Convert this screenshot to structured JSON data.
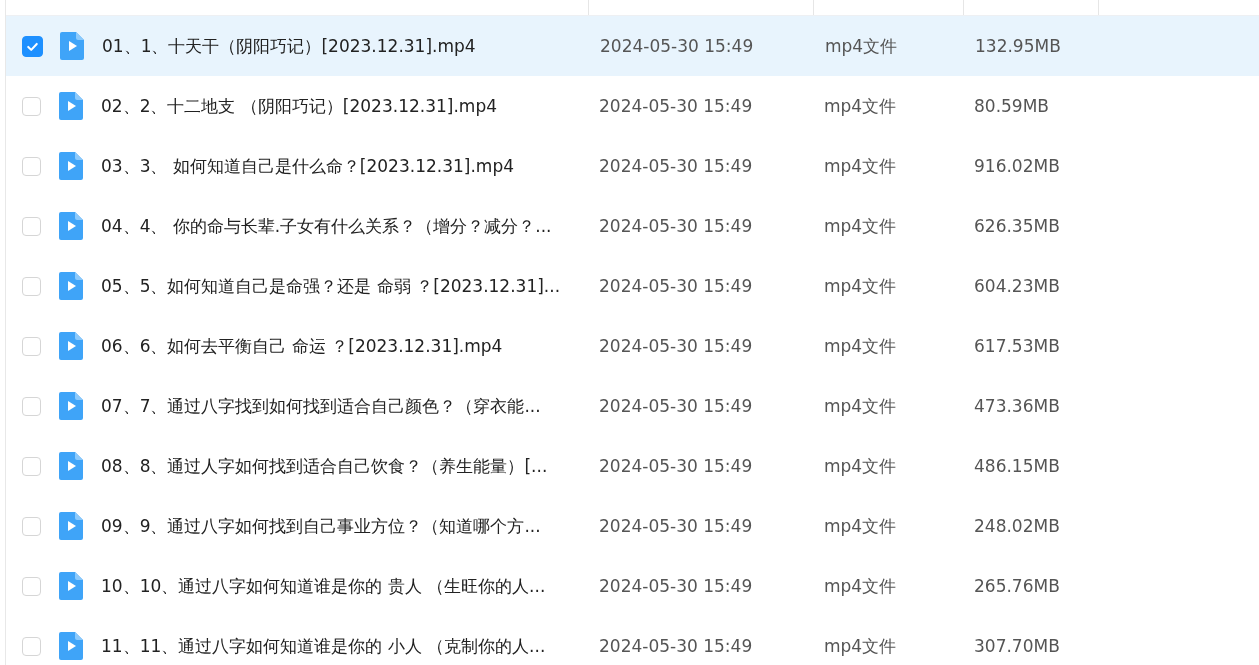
{
  "table": {
    "columns": [
      {
        "kind": "check"
      },
      {
        "kind": "name"
      },
      {
        "kind": "date"
      },
      {
        "kind": "type"
      },
      {
        "kind": "size"
      }
    ],
    "rows": [
      {
        "selected": true,
        "name": "01、1、十天干（阴阳巧记）[2023.12.31].mp4",
        "modified": "2024-05-30 15:49",
        "type": "mp4文件",
        "size": "132.95MB"
      },
      {
        "selected": false,
        "name": "02、2、十二地支 （阴阳巧记）[2023.12.31].mp4",
        "modified": "2024-05-30 15:49",
        "type": "mp4文件",
        "size": "80.59MB"
      },
      {
        "selected": false,
        "name": "03、3、 如何知道自己是什么命？[2023.12.31].mp4",
        "modified": "2024-05-30 15:49",
        "type": "mp4文件",
        "size": "916.02MB"
      },
      {
        "selected": false,
        "name": "04、4、 你的命与长辈.子女有什么关系？（增分？减分？...",
        "modified": "2024-05-30 15:49",
        "type": "mp4文件",
        "size": "626.35MB"
      },
      {
        "selected": false,
        "name": "05、5、如何知道自己是命强？还是 命弱 ？[2023.12.31]...",
        "modified": "2024-05-30 15:49",
        "type": "mp4文件",
        "size": "604.23MB"
      },
      {
        "selected": false,
        "name": "06、6、如何去平衡自己 命运 ？[2023.12.31].mp4",
        "modified": "2024-05-30 15:49",
        "type": "mp4文件",
        "size": "617.53MB"
      },
      {
        "selected": false,
        "name": "07、7、通过八字找到如何找到适合自己颜色？（穿衣能...",
        "modified": "2024-05-30 15:49",
        "type": "mp4文件",
        "size": "473.36MB"
      },
      {
        "selected": false,
        "name": "08、8、通过人字如何找到适合自己饮食？（养生能量）[...",
        "modified": "2024-05-30 15:49",
        "type": "mp4文件",
        "size": "486.15MB"
      },
      {
        "selected": false,
        "name": "09、9、通过八字如何找到自己事业方位？（知道哪个方...",
        "modified": "2024-05-30 15:49",
        "type": "mp4文件",
        "size": "248.02MB"
      },
      {
        "selected": false,
        "name": "10、10、通过八字如何知道谁是你的 贵人 （生旺你的人...",
        "modified": "2024-05-30 15:49",
        "type": "mp4文件",
        "size": "265.76MB"
      },
      {
        "selected": false,
        "name": "11、11、通过八字如何知道谁是你的 小人 （克制你的人...",
        "modified": "2024-05-30 15:49",
        "type": "mp4文件",
        "size": "307.70MB"
      }
    ]
  }
}
